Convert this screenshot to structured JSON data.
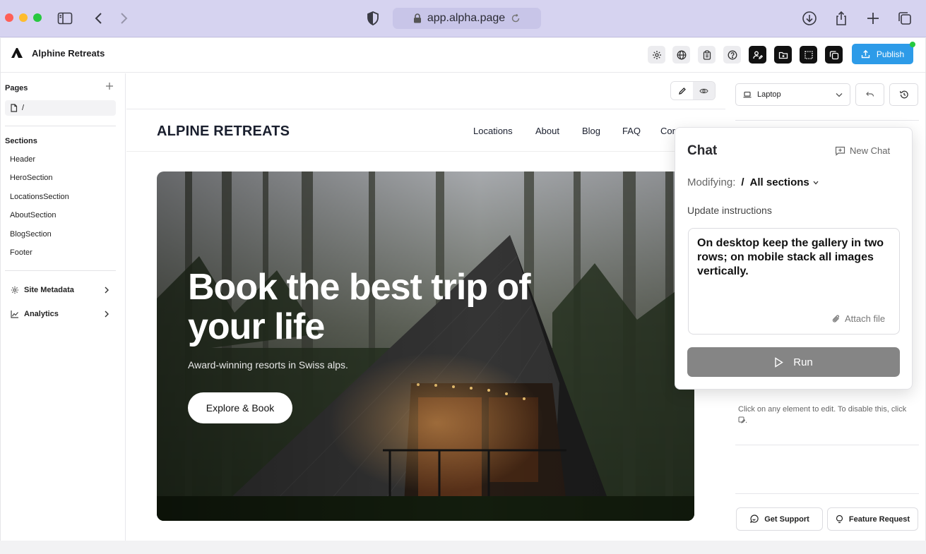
{
  "browser": {
    "url": "app.alpha.page",
    "traffic_lights": [
      "#ff5f57",
      "#febc2e",
      "#28c840"
    ]
  },
  "app": {
    "brand": "Alphine Retreats",
    "toolbar_icons": [
      "settings-icon",
      "globe-icon",
      "clipboard-icon",
      "help-icon",
      "user-edit-icon",
      "folder-icon",
      "crop-icon",
      "copy-icon"
    ],
    "publish_label": "Publish",
    "accent": "#2d9be8"
  },
  "sidebar": {
    "pages_title": "Pages",
    "page_item": "/",
    "sections_title": "Sections",
    "sections": [
      "Header",
      "HeroSection",
      "LocationsSection",
      "AboutSection",
      "BlogSection",
      "Footer"
    ],
    "extras": [
      {
        "label": "Site Metadata",
        "icon": "gear-icon"
      },
      {
        "label": "Analytics",
        "icon": "chart-line-icon"
      }
    ]
  },
  "site": {
    "logo": "ALPINE RETREATS",
    "nav": [
      "Locations",
      "About",
      "Blog",
      "FAQ",
      "Cor"
    ],
    "hero_title": "Book the best trip of your life",
    "hero_subtitle": "Award-winning resorts in Swiss alps.",
    "hero_cta": "Explore & Book"
  },
  "right_panel": {
    "device": "Laptop",
    "hint": "Click on any element to edit. To disable this, click",
    "get_support": "Get Support",
    "feature_request": "Feature Request"
  },
  "chat": {
    "title": "Chat",
    "new_chat": "New Chat",
    "modifying_label": "Modifying:",
    "modifying_page": "/",
    "modifying_target": "All sections",
    "update_label": "Update instructions",
    "instructions": "On desktop keep the gallery in two rows; on mobile stack all images vertically.",
    "attach": "Attach file",
    "run": "Run"
  }
}
